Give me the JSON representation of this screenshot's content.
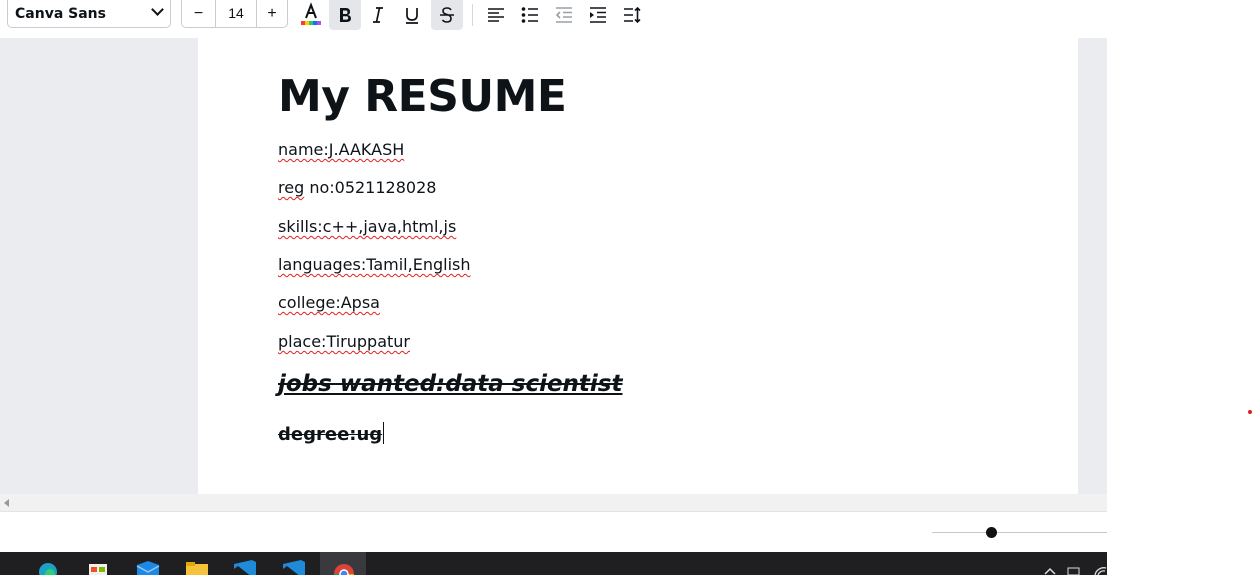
{
  "toolbar": {
    "font_family": "Canva Sans",
    "font_size": "14",
    "decrease_label": "−",
    "increase_label": "+",
    "bold_active": true,
    "strikethrough_active": true,
    "text_color_bar": [
      "#ff3b30",
      "#ffcc00",
      "#34c759",
      "#007aff",
      "#af52de"
    ],
    "icons": [
      "text-color-icon",
      "bold-icon",
      "italic-icon",
      "underline-icon",
      "strikethrough-icon",
      "align-left-icon",
      "bulleted-list-icon",
      "outdent-icon",
      "indent-icon",
      "line-spacing-icon"
    ]
  },
  "document": {
    "title": "My RESUME",
    "lines": [
      {
        "id": "name",
        "text": "name:J.AAKASH"
      },
      {
        "id": "reg",
        "prefix": "reg",
        "text": " no:0521128028"
      },
      {
        "id": "skills",
        "text": "skills:c++,java,html,js"
      },
      {
        "id": "languages",
        "text": "languages:Tamil,English"
      },
      {
        "id": "college",
        "text": "college:Apsa"
      },
      {
        "id": "place",
        "text": "place:Tiruppatur"
      }
    ],
    "jobs": "jobs wanted:data scientist",
    "degree": "degree:ug"
  },
  "colors": {
    "text": "#0e1318",
    "canvas_bg": "#ebecf0",
    "spellcheck": "#e02020",
    "taskbar": "#1f1f22"
  },
  "taskbar": {
    "apps": [
      "edge-icon",
      "store-icon",
      "mail-icon",
      "file-explorer-icon",
      "vscode-icon",
      "vscode-icon",
      "chrome-icon"
    ],
    "active_app": "chrome-icon"
  }
}
